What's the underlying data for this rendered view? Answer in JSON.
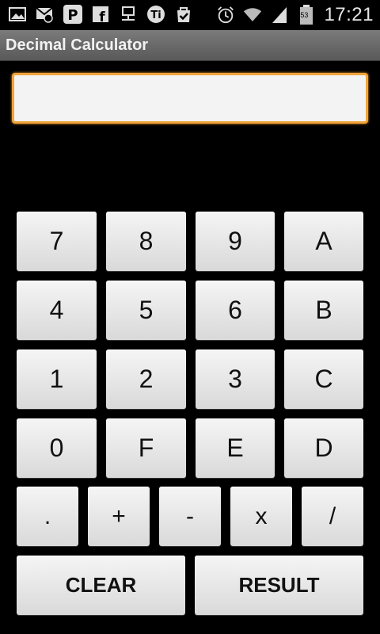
{
  "status_bar": {
    "time": "17:21",
    "battery_level": "53",
    "icons": [
      "picture-icon",
      "gmail-icon",
      "pinterest-icon",
      "facebook-icon",
      "network-icon",
      "tinfoil-icon",
      "check-bag-icon",
      "alarm-icon",
      "wifi-icon",
      "signal-icon",
      "battery-icon"
    ]
  },
  "title": "Decimal Calculator",
  "display": {
    "value": "",
    "placeholder": ""
  },
  "keys": {
    "r1": [
      "7",
      "8",
      "9",
      "A"
    ],
    "r2": [
      "4",
      "5",
      "6",
      "B"
    ],
    "r3": [
      "1",
      "2",
      "3",
      "C"
    ],
    "r4": [
      "0",
      "F",
      "E",
      "D"
    ],
    "ops": [
      ".",
      "+",
      "-",
      "x",
      "/"
    ],
    "clear": "CLEAR",
    "result": "RESULT"
  }
}
